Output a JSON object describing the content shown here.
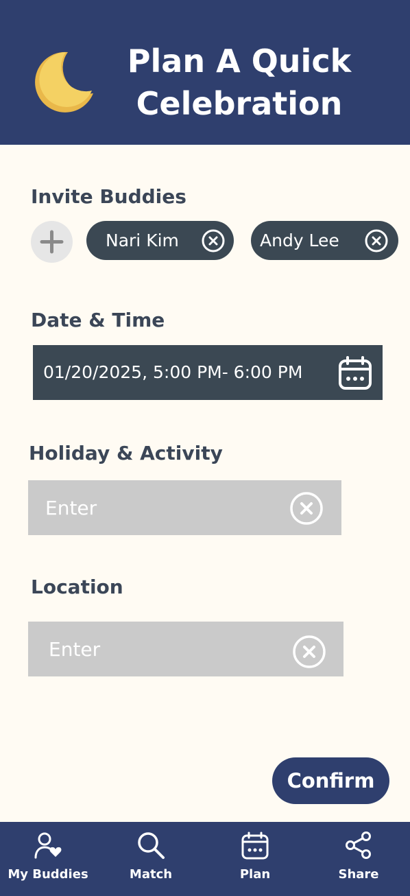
{
  "header": {
    "title_line1": "Plan A Quick",
    "title_line2": "Celebration",
    "icon": "crescent-moon-icon"
  },
  "invite": {
    "label": "Invite Buddies",
    "add_icon": "plus-icon",
    "buddies": [
      {
        "name": "Nari Kim",
        "remove_icon": "close-circle-icon"
      },
      {
        "name": "Andy Lee",
        "remove_icon": "close-circle-icon"
      }
    ]
  },
  "datetime": {
    "label": "Date & Time",
    "value": "01/20/2025, 5:00 PM- 6:00 PM",
    "icon": "calendar-icon"
  },
  "activity": {
    "label": "Holiday & Activity",
    "placeholder": "Enter",
    "clear_icon": "close-circle-icon"
  },
  "location": {
    "label": "Location",
    "placeholder": "Enter",
    "clear_icon": "close-circle-icon"
  },
  "confirm_label": "Confirm",
  "bottom_nav": [
    {
      "label": "My Buddies",
      "icon": "buddies-heart-icon"
    },
    {
      "label": "Match",
      "icon": "search-icon"
    },
    {
      "label": "Plan",
      "icon": "calendar-icon"
    },
    {
      "label": "Share",
      "icon": "share-icon"
    }
  ],
  "colors": {
    "primary": "#2f3f6e",
    "background": "#fffbf3",
    "chip": "#3b4853",
    "input_bg": "#cacaca",
    "moon": "#f2cd5c",
    "label_text": "#3b4657"
  }
}
